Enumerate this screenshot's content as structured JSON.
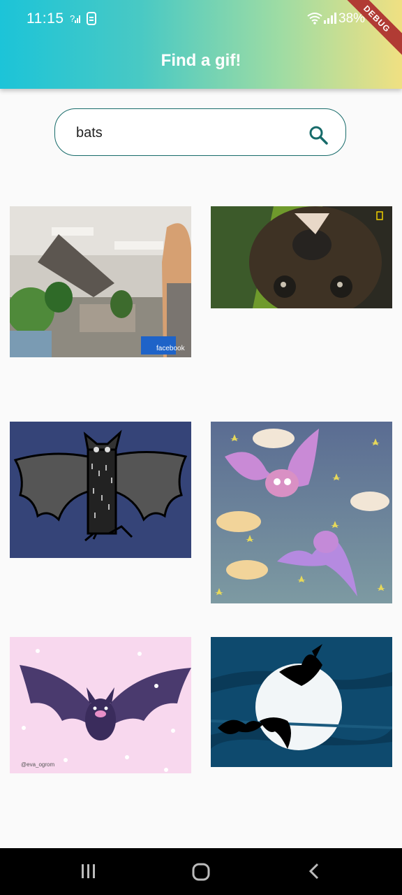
{
  "status_bar": {
    "time": "11:15",
    "battery": "38%",
    "debug_banner": "DEBUG"
  },
  "app_bar": {
    "title": "Find a gif!"
  },
  "search": {
    "value": "bats",
    "icon": "search-icon"
  },
  "gifs": [
    {
      "description_icon": "gif-office-scene"
    },
    {
      "description_icon": "gif-hanging-fruit-bat"
    },
    {
      "description_icon": "gif-drawn-bat"
    },
    {
      "description_icon": "gif-purple-cartoon-bats"
    },
    {
      "description_icon": "gif-pink-bat-illustration"
    },
    {
      "description_icon": "gif-bat-silhouettes-moon"
    }
  ],
  "gif_watermarks": {
    "facebook": "facebook",
    "artist": "@eva_ogrom"
  },
  "colors": {
    "accent": "#176b6a",
    "header_start": "#1cc4d8",
    "header_end": "#f0e082",
    "debug": "#b13b34"
  }
}
